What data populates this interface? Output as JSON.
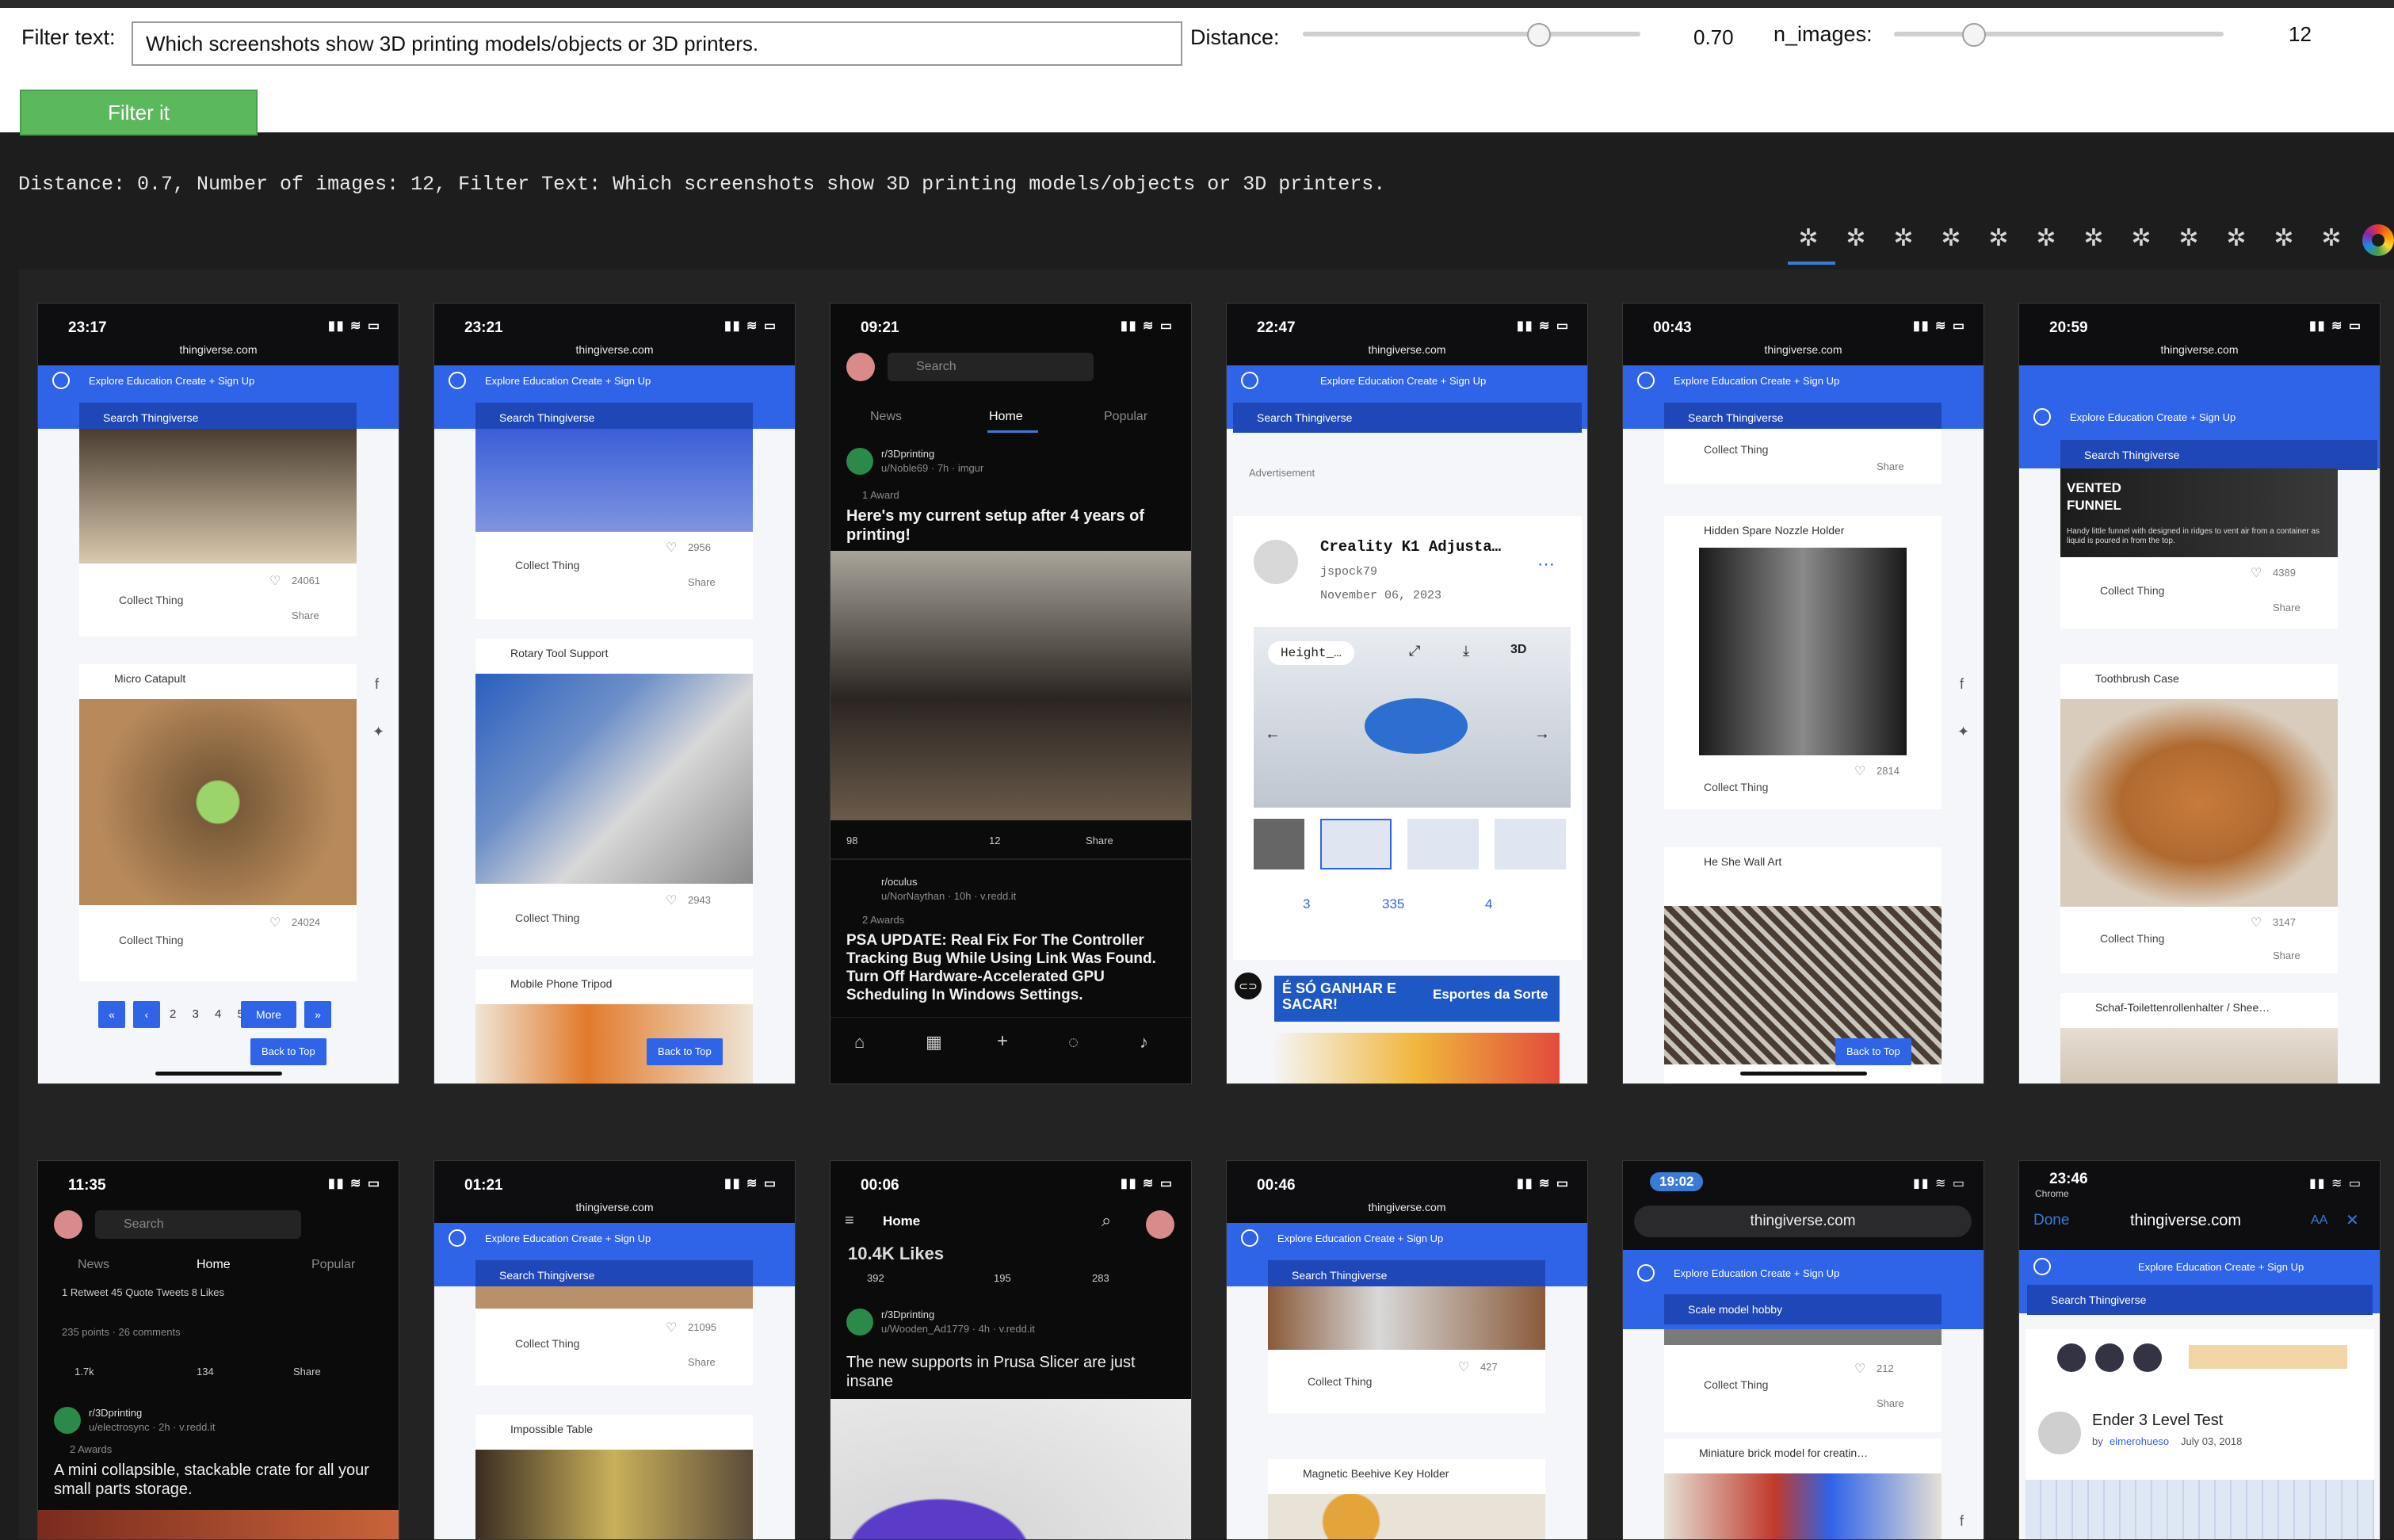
{
  "controls": {
    "filter_label": "Filter text:",
    "filter_value": "Which screenshots show 3D printing models/objects or 3D printers.",
    "distance_label": "Distance:",
    "distance_value": "0.70",
    "distance_level": 0.7,
    "n_images_label": "n_images:",
    "n_images_value": "12",
    "filter_button": "Filter it"
  },
  "status": "Distance: 0.7, Number of images: 12, Filter Text: Which screenshots show 3D printing models/objects or 3D printers.",
  "colors": {
    "filter_button": "#5cb85c",
    "thingiverse_blue": "#2f63e8",
    "page_bg": "#1d1d1d",
    "tab_underline": "#3a7bd5"
  },
  "results": [
    {
      "time": "23:17",
      "url": "thingiverse.com",
      "nav": "Explore  Education  Create +  Sign Up",
      "search": "Search Thingiverse",
      "card_likes_1": "24061",
      "collect": "Collect Thing",
      "share": "Share",
      "card_title_2": "Micro Catapult",
      "card_likes_2": "24024",
      "pages": "2 3 4 5",
      "more": "More",
      "back_to_top": "Back to Top"
    },
    {
      "time": "23:21",
      "url": "thingiverse.com",
      "nav": "Explore  Education  Create +  Sign Up",
      "search": "Search Thingiverse",
      "card_likes_1": "2956",
      "collect": "Collect Thing",
      "share": "Share",
      "card_title_2": "Rotary Tool Support",
      "card_likes_2": "2943",
      "card_title_3": "Mobile Phone Tripod",
      "back_to_top": "Back to Top"
    },
    {
      "time": "09:21",
      "search": "Search",
      "tabs": [
        "News",
        "Home",
        "Popular"
      ],
      "sub": "r/3Dprinting",
      "user": "u/Noble69 · 7h · imgur",
      "award": "1 Award",
      "title": "Here's my current setup after 4 years of printing!",
      "votes": "98",
      "comments": "12",
      "share": "Share",
      "sub2": "r/oculus",
      "user2": "u/NorNaythan · 10h · v.redd.it",
      "award2": "2 Awards",
      "title2": "PSA UPDATE: Real Fix For The Controller Tracking Bug While Using Link Was Found. Turn Off Hardware-Accelerated GPU Scheduling In Windows Settings."
    },
    {
      "time": "22:47",
      "url": "thingiverse.com",
      "nav": "Explore   Education   Create +   Sign Up",
      "search": "Search Thingiverse",
      "ad": "Advertisement",
      "thing_title": "Creality K1 Adjusta…",
      "author": "jspock79",
      "date": "November 06, 2023",
      "chip": "Height_…",
      "remixes": "3",
      "likes": "335",
      "collections": "4",
      "ad_banner": "É SÓ GANHAR E SACAR!",
      "ad_brand": "Esportes da Sorte"
    },
    {
      "time": "00:43",
      "url": "thingiverse.com",
      "nav": "Explore  Education  Create +  Sign Up",
      "search": "Search Thingiverse",
      "collect": "Collect Thing",
      "share": "Share",
      "card_title_1": "Hidden Spare Nozzle Holder",
      "card_likes_1": "2814",
      "card_title_2": "He She Wall Art",
      "back_to_top": "Back to Top"
    },
    {
      "time": "20:59",
      "url": "thingiverse.com",
      "nav": "Explore  Education  Create +  Sign Up",
      "search": "Search Thingiverse",
      "banner_title": "VENTED FUNNEL",
      "banner_text": "Handy little funnel with designed in ridges to vent air from a container as liquid is poured in from the top.",
      "card_likes_1": "4389",
      "collect": "Collect Thing",
      "share": "Share",
      "card_title_2": "Toothbrush Case",
      "card_likes_2": "3147",
      "card_title_3": "Schaf-Toilettenrollenhalter / Shee…"
    },
    {
      "time": "11:35",
      "search": "Search",
      "tabs": [
        "News",
        "Home",
        "Popular"
      ],
      "stats": "1 Retweet  45 Quote Tweets  8 Likes",
      "points": "235 points · 26 comments",
      "votes": "1.7k",
      "comments": "134",
      "share": "Share",
      "sub": "r/3Dprinting",
      "user": "u/electrosync · 2h · v.redd.it",
      "award": "2 Awards",
      "title": "A mini collapsible, stackable crate for all your small parts storage."
    },
    {
      "time": "01:21",
      "url": "thingiverse.com",
      "nav": "Explore  Education  Create +  Sign Up",
      "search": "Search Thingiverse",
      "collect": "Collect Thing",
      "card_likes_1": "21095",
      "share": "Share",
      "card_title_2": "Impossible Table"
    },
    {
      "time": "00:06",
      "home": "Home",
      "likes_banner": "10.4K Likes",
      "votes": "392",
      "comments": "195",
      "shares": "283",
      "sub": "r/3Dprinting",
      "user": "u/Wooden_Ad1779 · 4h · v.redd.it",
      "title": "The new supports in Prusa Slicer are just insane"
    },
    {
      "time": "00:46",
      "url": "thingiverse.com",
      "nav": "Explore  Education  Create +  Sign Up",
      "search": "Search Thingiverse",
      "collect": "Collect Thing",
      "card_likes_1": "427",
      "card_title_2": "Magnetic Beehive Key Holder"
    },
    {
      "time": "19:02",
      "url": "thingiverse.com",
      "nav": "Explore  Education  Create +  Sign Up",
      "search": "Scale model hobby",
      "collect": "Collect Thing",
      "card_likes_1": "212",
      "share": "Share",
      "card_title_2": "Miniature brick model for creatin…"
    },
    {
      "time": "23:46",
      "app": "Chrome",
      "done": "Done",
      "url": "thingiverse.com",
      "aa": "AA",
      "nav": "Explore  Education  Create +  Sign Up",
      "search": "Search Thingiverse",
      "thing_title": "Ender 3 Level Test",
      "by": "by",
      "author": "elmerohueso",
      "date": "July 03, 2018"
    }
  ]
}
